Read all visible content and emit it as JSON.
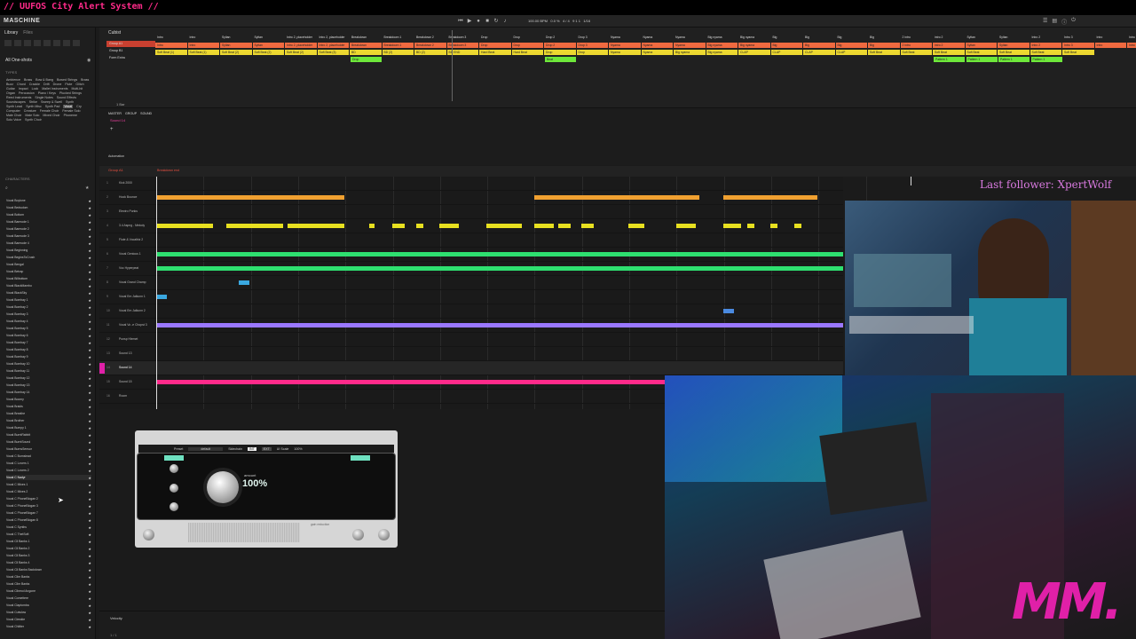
{
  "stream_title": "// UUFOS City Alert System //",
  "app": {
    "logo": "MASCHINE"
  },
  "transport": {
    "tempo": "100.00 BPM",
    "swing": "0.0 %",
    "signature": "4 / 4",
    "position": "9 1 1",
    "grid": "1/16"
  },
  "sidebar": {
    "tabs": [
      "Library",
      "Files"
    ],
    "section": "All One-shots",
    "types_heading": "TYPES",
    "type_tags": [
      "Ambience",
      "Brass",
      "Bow & Bang",
      "Bowed Strings",
      "Brass",
      "Buzz",
      "Chord",
      "Crackle",
      "Drift",
      "Drone",
      "Flute",
      "Glitch",
      "Guitar",
      "Impact",
      "Lock",
      "Mallet Instruments",
      "Multi-hit",
      "Organ",
      "Percussion",
      "Piano / Keys",
      "Plucked Strings",
      "Reed Instruments",
      "Single Notes",
      "Sound Effects",
      "Soundscapes",
      "Strike",
      "Sweep & Swell",
      "Synth",
      "Synth Lead",
      "Synth Misc",
      "Synth Pad",
      "Vocal",
      "Cry",
      "Computer",
      "Creature",
      "Female Choir",
      "Female Solo",
      "Male Choir",
      "Male Solo",
      "Mixed Choir",
      "Phoneme",
      "Solo Voice",
      "Synth Choir"
    ],
    "characters_heading": "CHARACTERS",
    "vocal_list": [
      "Vocal Boytone",
      "Vocal Bedsolom",
      "Vocal Bottom",
      "Vocal Barmode 1",
      "Vocal Barmode 2",
      "Vocal Barmode 3",
      "Vocal Barmode 4",
      "Vocal Beginning",
      "Vocal BeginsToCrush",
      "Vocal Bengal",
      "Vocal Betrap",
      "Vocal Billbottom",
      "Vocal BlackMambo",
      "Vocal BlackSky",
      "Vocal Bombay 1",
      "Vocal Bombay 2",
      "Vocal Bombay 3",
      "Vocal Bombay 4",
      "Vocal Bombay 5",
      "Vocal Bombay 6",
      "Vocal Bombay 7",
      "Vocal Bombay 8",
      "Vocal Bombay 9",
      "Vocal Bombay 10",
      "Vocal Bombay 11",
      "Vocal Bombay 12",
      "Vocal Bombay 13",
      "Vocal Bombay 14",
      "Vocal Boomy",
      "Vocal Braids",
      "Vocal Breathe",
      "Vocal Brother",
      "Vocal Bumpy 1",
      "Vocal BurntRabbit",
      "Vocal BurntSound",
      "Vocal BurnsSensor",
      "Vocal C Burnslead",
      "Vocal C Lovers 1",
      "Vocal C Lovers 2",
      "Vocal C Nadyr",
      "Vocal C Mixes 1",
      "Vocal C Mixes 2",
      "Vocal C PhoneBlogan 2",
      "Vocal C PhoneBlogan 3",
      "Vocal C PhoneBlogan 7",
      "Vocal C PhoneBlogan 8",
      "Vocal C Synths",
      "Vocal C ThetSoft",
      "Vocal Cll Banks 1",
      "Vocal Cll Banks 2",
      "Vocal Cll Banks 3",
      "Vocal Cll Banks 4",
      "Vocal Cll Banks Backdown",
      "Vocal Cllm Banks",
      "Vocal Cllm Banks",
      "Vocal Cllnecd Angone",
      "Vocal Comettere",
      "Vocal Claptomba",
      "Vocal Cutwlow",
      "Vocal Clewkie",
      "Vocal Chlitter"
    ],
    "selected_index": 39
  },
  "arranger": {
    "tab": "Cubist",
    "groups": [
      "Group A1",
      "Group B1",
      "Form Extra"
    ],
    "sections_row1": [
      "Intro",
      "Intro",
      "Syltan",
      "Syltan",
      "Intro 2, placeholder",
      "Intro 2, placeholder",
      "Breakdown",
      "Breakdown 1",
      "Breakdown 2",
      "Breakdown 3",
      "Drop",
      "Drop",
      "Drop 2",
      "Drop 3",
      "Nyama",
      "Nyama",
      "Nyama",
      "Big nyama",
      "Big nyama",
      "Big",
      "Big",
      "Big",
      "Big",
      "2 intro",
      "intro 2",
      "Syltan",
      "Syltan",
      "Intro 2",
      "Intro 3",
      "Intro",
      "Intro"
    ],
    "sections_row2": [
      "Soft Beat (1)",
      "Soft Beat (1)",
      "Soft Beat (2)",
      "Soft Beat (2)",
      "Soft Beat (2)",
      "Soft Beat (3)",
      "BD",
      "BD (2)",
      "BD (2)",
      "BD END",
      "Hard Beat",
      "Hard Beat",
      "Drop",
      "Drop",
      "Nyama",
      "Nyama",
      "Big nyama",
      "Big nyama",
      "CLAP",
      "CLAP",
      "CLAP",
      "CLAP",
      "Soft Beat",
      "Soft Beat",
      "Soft Beat",
      "Soft Beat",
      "Soft Beat",
      "Soft Beat",
      "Soft Beat"
    ],
    "sections_row3": [
      "Drop",
      "Beat",
      "Pattern 1",
      "Pattern 1",
      "Pattern 1",
      "Pattern 1"
    ],
    "bar_label": "1 Bar"
  },
  "mid": {
    "tabs": [
      "MASTER",
      "GROUP",
      "SOUND"
    ],
    "sound": "Sound 14",
    "automation": "Automation"
  },
  "pattern": {
    "group_label": "Group A1",
    "pattern_name": "Breakdown end",
    "lanes": [
      "Kick 2000",
      "Hook Bounce",
      "Electro Punks",
      "3.4 Aspng - Melody",
      "Flute & Vocalbiz 2",
      "Vocal Genious 1",
      "Voc Hyperpeat",
      "Vocal Grand Champ",
      "Vocal Em Jalkunn 1",
      "Vocal Em Jalkunn 2",
      "Vocal Vo -e Chopst 3",
      "Punsp Hlemet",
      "Sound 13",
      "Sound 14",
      "Sound 15",
      "Room"
    ]
  },
  "plugin": {
    "preset_label": "Preset",
    "preset": "default",
    "sidechain": "Sidechain",
    "int": "INT",
    "ext": "EXT",
    "ui_scale": "UI Scale",
    "scale_val": "100%",
    "amount_label": "amount",
    "amount": "100%",
    "gain_reduction": "gain reduction"
  },
  "overlay": {
    "follower": "Last follower: XpertWolf",
    "logo": "MM."
  },
  "bottom": {
    "velocity": "Velocity",
    "page": "1 / 1"
  },
  "colors": {
    "orange": "#f0a030",
    "yellow": "#e8e020",
    "green": "#2ee070",
    "blue": "#3aa8e0",
    "purple": "#9a78ff",
    "pink": "#ff2a8a",
    "red": "#e85040"
  }
}
